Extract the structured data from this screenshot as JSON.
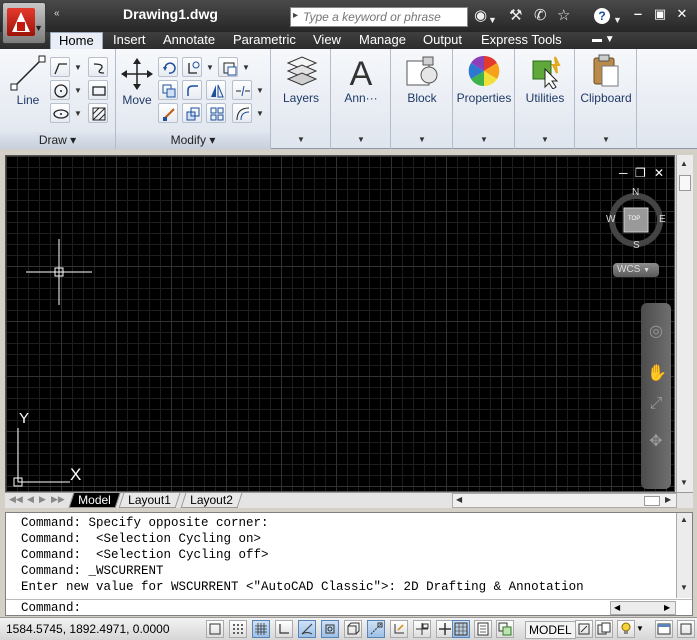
{
  "window": {
    "title": "Drawing1.dwg",
    "qat_label": "«",
    "search_placeholder": "Type a keyword or phrase",
    "minimize": "‒",
    "restore": "▣",
    "close": "✕"
  },
  "ribbon_tabs": [
    {
      "label": "Home",
      "active": true
    },
    {
      "label": "Insert"
    },
    {
      "label": "Annotate"
    },
    {
      "label": "Parametric"
    },
    {
      "label": "View"
    },
    {
      "label": "Manage"
    },
    {
      "label": "Output"
    },
    {
      "label": "Express Tools"
    }
  ],
  "panels": {
    "draw": {
      "footer": "Draw",
      "line_label": "Line"
    },
    "modify": {
      "footer": "Modify",
      "move_label": "Move"
    },
    "layers": {
      "label": "Layers"
    },
    "annotation": {
      "label": "Ann···"
    },
    "block": {
      "label": "Block"
    },
    "properties": {
      "label": "Properties"
    },
    "utilities": {
      "label": "Utilities"
    },
    "clipboard": {
      "label": "Clipboard"
    }
  },
  "viewcube": {
    "north": "N",
    "south": "S",
    "east": "E",
    "west": "W",
    "face": "TOP",
    "wcs_label": "WCS"
  },
  "ucs": {
    "y_label": "Y",
    "x_label": "X"
  },
  "layout_tabs": [
    "Model",
    "Layout1",
    "Layout2"
  ],
  "command_history": [
    "Command: Specify opposite corner:",
    "Command:  <Selection Cycling on>",
    "Command:  <Selection Cycling off>",
    "Command: _WSCURRENT",
    "Enter new value for WSCURRENT <\"AutoCAD Classic\">: 2D Drafting & Annotation"
  ],
  "command_prompt": "Command:",
  "status": {
    "coordinates": "1584.5745, 1892.4971, 0.0000",
    "space": "MODEL"
  }
}
